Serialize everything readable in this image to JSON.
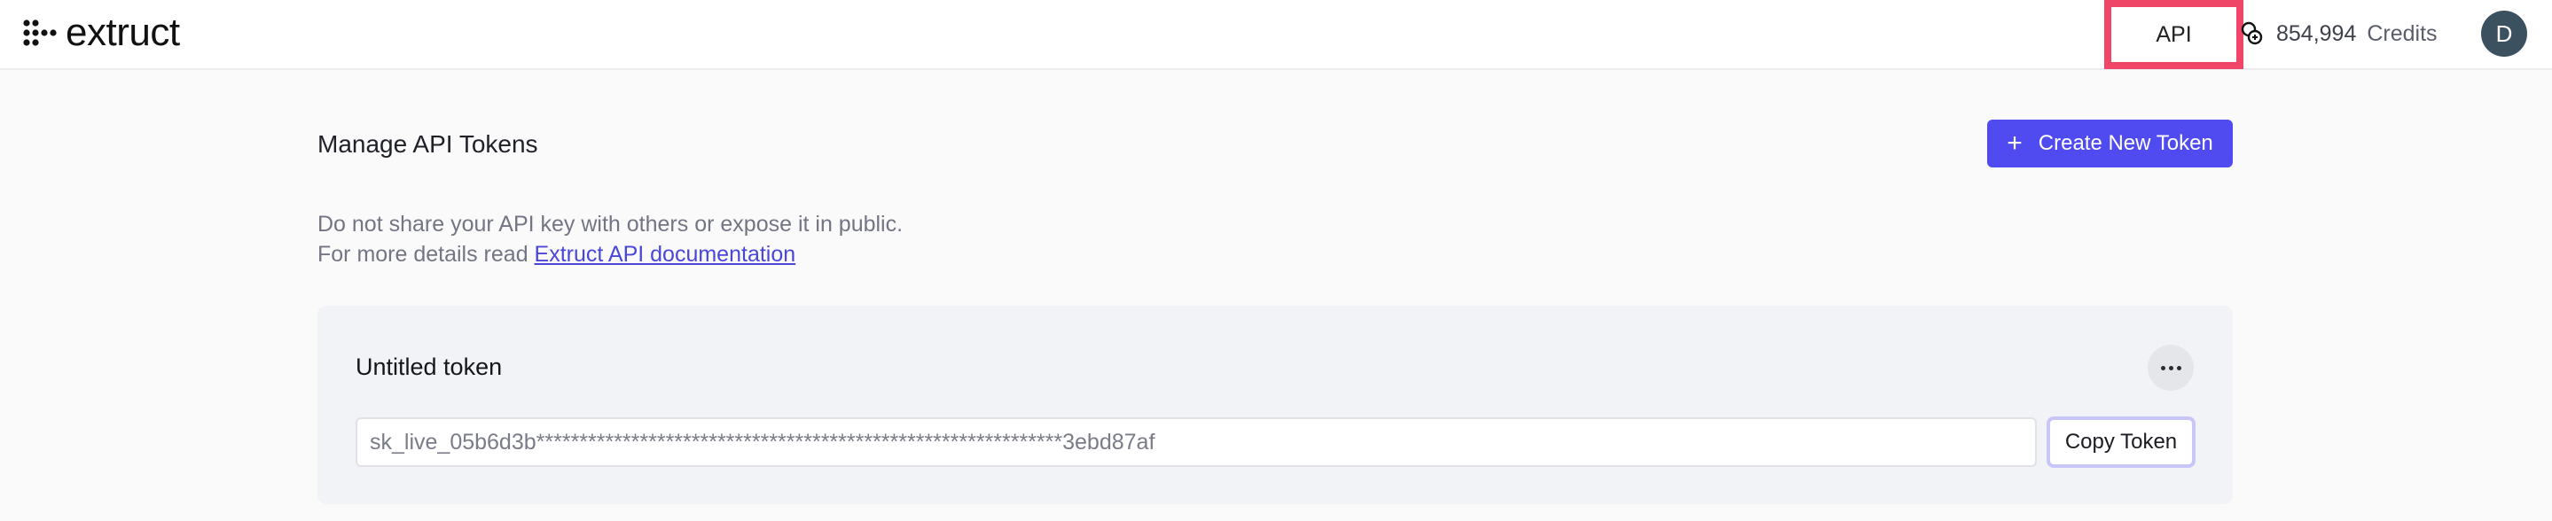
{
  "header": {
    "logo_text": "extruct",
    "nav_api_label": "API",
    "credits_value": "854,994",
    "credits_label": "Credits",
    "avatar_initial": "D"
  },
  "main": {
    "title": "Manage API Tokens",
    "create_button_label": "Create New Token",
    "description_line1": "Do not share your API key with others or expose it in public.",
    "description_line2_prefix": "For more details read ",
    "docs_link_text": "Extruct API documentation"
  },
  "tokens": [
    {
      "name": "Untitled token",
      "masked_value": "sk_live_05b6d3b*************************************************************3ebd87af",
      "copy_label": "Copy Token"
    }
  ],
  "colors": {
    "accent": "#4f4bf0",
    "highlight_border": "#ef4566",
    "avatar_bg": "#3c5160"
  },
  "icons": {
    "logo": "extruct-dots-logo-icon",
    "credits": "coins-icon",
    "create": "plus-icon",
    "more": "ellipsis-icon"
  }
}
